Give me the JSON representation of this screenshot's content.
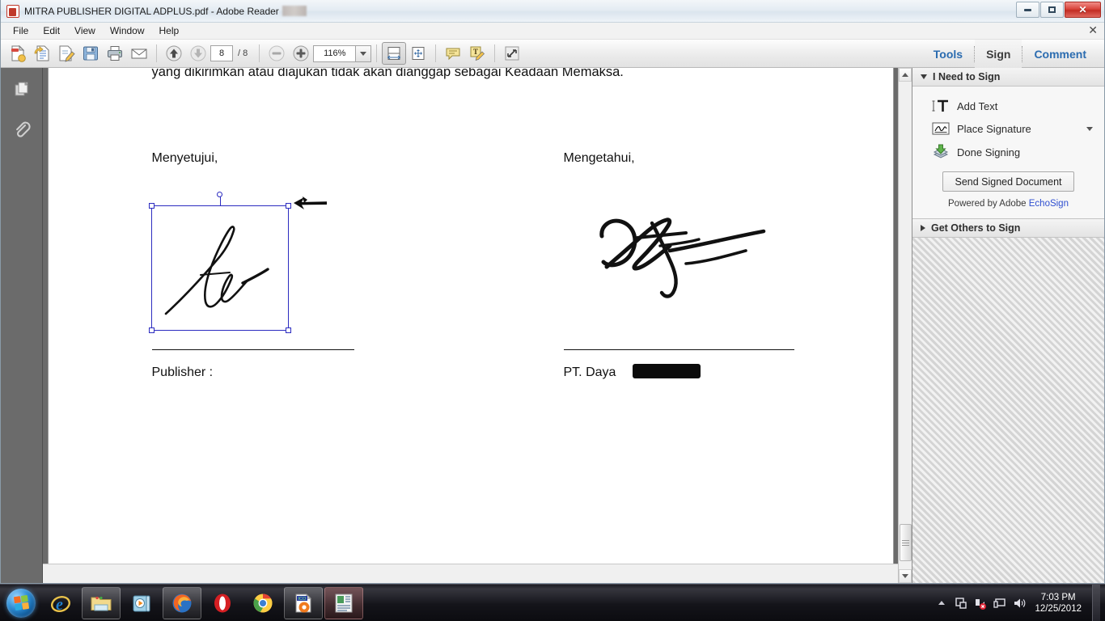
{
  "window": {
    "title": "MITRA PUBLISHER DIGITAL ADPLUS.pdf - Adobe Reader",
    "app_icon": "pdf-file-icon",
    "controls": {
      "minimize": "minimize-icon",
      "maximize": "restore-icon",
      "close": "close-icon"
    }
  },
  "menu": {
    "items": [
      {
        "label": "File"
      },
      {
        "label": "Edit"
      },
      {
        "label": "View"
      },
      {
        "label": "Window"
      },
      {
        "label": "Help"
      }
    ],
    "close_x": "✕"
  },
  "toolbar": {
    "buttons": [
      {
        "name": "create-pdf-icon",
        "title": "Create PDF"
      },
      {
        "name": "export-pdf-icon",
        "title": "Export PDF"
      },
      {
        "name": "edit-pdf-icon",
        "title": "Edit PDF"
      },
      {
        "name": "save-icon",
        "title": "Save"
      },
      {
        "name": "print-icon",
        "title": "Print"
      },
      {
        "name": "email-icon",
        "title": "Email"
      }
    ],
    "nav": {
      "prev": "previous-page-icon",
      "next": "next-page-icon"
    },
    "page_current": "8",
    "page_total": "/ 8",
    "zoom_out": "zoom-out-icon",
    "zoom_in": "zoom-in-icon",
    "zoom_value": "116%",
    "view_buttons": [
      {
        "name": "fit-width-icon",
        "selected": true
      },
      {
        "name": "fit-page-icon",
        "selected": false
      }
    ],
    "comment_buttons": [
      {
        "name": "sticky-note-icon"
      },
      {
        "name": "text-comment-icon"
      }
    ],
    "fullscreen": "fullscreen-icon",
    "tabs": [
      {
        "label": "Tools",
        "active": false
      },
      {
        "label": "Sign",
        "active": true
      },
      {
        "label": "Comment",
        "active": false
      }
    ]
  },
  "nav_rail": {
    "buttons": [
      {
        "name": "page-thumbnails-icon"
      },
      {
        "name": "attachments-icon"
      }
    ]
  },
  "document": {
    "top_line": "yang dikirimkan atau diajukan tidak akan dianggap sebagai Keadaan Memaksa.",
    "left_column": {
      "heading": "Menyetujui,",
      "caption": "Publisher :",
      "signature": "handwritten-signature-selected"
    },
    "right_column": {
      "heading": "Mengetahui,",
      "caption_visible": "PT. Daya",
      "caption_redacted": "redacted-company-name",
      "signature": "handwritten-signature"
    },
    "cursor": "arrow-pointer-cursor",
    "selection": {
      "handles": 4,
      "rotate_handle": true,
      "color": "#2b2bc0"
    }
  },
  "sign_panel": {
    "sections": [
      {
        "title": "I Need to Sign",
        "expanded": true,
        "rows": [
          {
            "label": "Add Text",
            "icon": "add-text-icon",
            "has_caret": false
          },
          {
            "label": "Place Signature",
            "icon": "place-signature-icon",
            "has_caret": true
          },
          {
            "label": "Done Signing",
            "icon": "done-signing-icon",
            "has_caret": false
          }
        ],
        "button": "Send Signed Document",
        "powered_prefix": "Powered by Adobe ",
        "powered_brand": "EchoSign"
      },
      {
        "title": "Get Others to Sign",
        "expanded": false,
        "rows": [],
        "button": "",
        "powered_prefix": "",
        "powered_brand": ""
      }
    ]
  },
  "taskbar": {
    "start": "windows-start-orb",
    "items": [
      {
        "name": "internet-explorer-icon",
        "state": "pinned"
      },
      {
        "name": "windows-explorer-icon",
        "state": "open"
      },
      {
        "name": "windows-media-player-icon",
        "state": "pinned"
      },
      {
        "name": "firefox-icon",
        "state": "open"
      },
      {
        "name": "opera-icon",
        "state": "pinned"
      },
      {
        "name": "google-chrome-icon",
        "state": "pinned"
      },
      {
        "name": "ico-file-icon",
        "state": "open"
      },
      {
        "name": "adobe-reader-icon",
        "state": "active"
      }
    ],
    "tray": [
      {
        "name": "show-hidden-icons-icon"
      },
      {
        "name": "devices-icon"
      },
      {
        "name": "network-error-icon"
      },
      {
        "name": "display-icon"
      },
      {
        "name": "volume-icon"
      }
    ],
    "clock_time": "7:03 PM",
    "clock_date": "12/25/2012"
  },
  "colors": {
    "accent_blue": "#2b6cb0",
    "selection_blue": "#2b2bc0",
    "echosign_blue": "#2f4fd0",
    "panel_bg": "#f5f5f5",
    "viewport_gray": "#6b6b6b"
  }
}
